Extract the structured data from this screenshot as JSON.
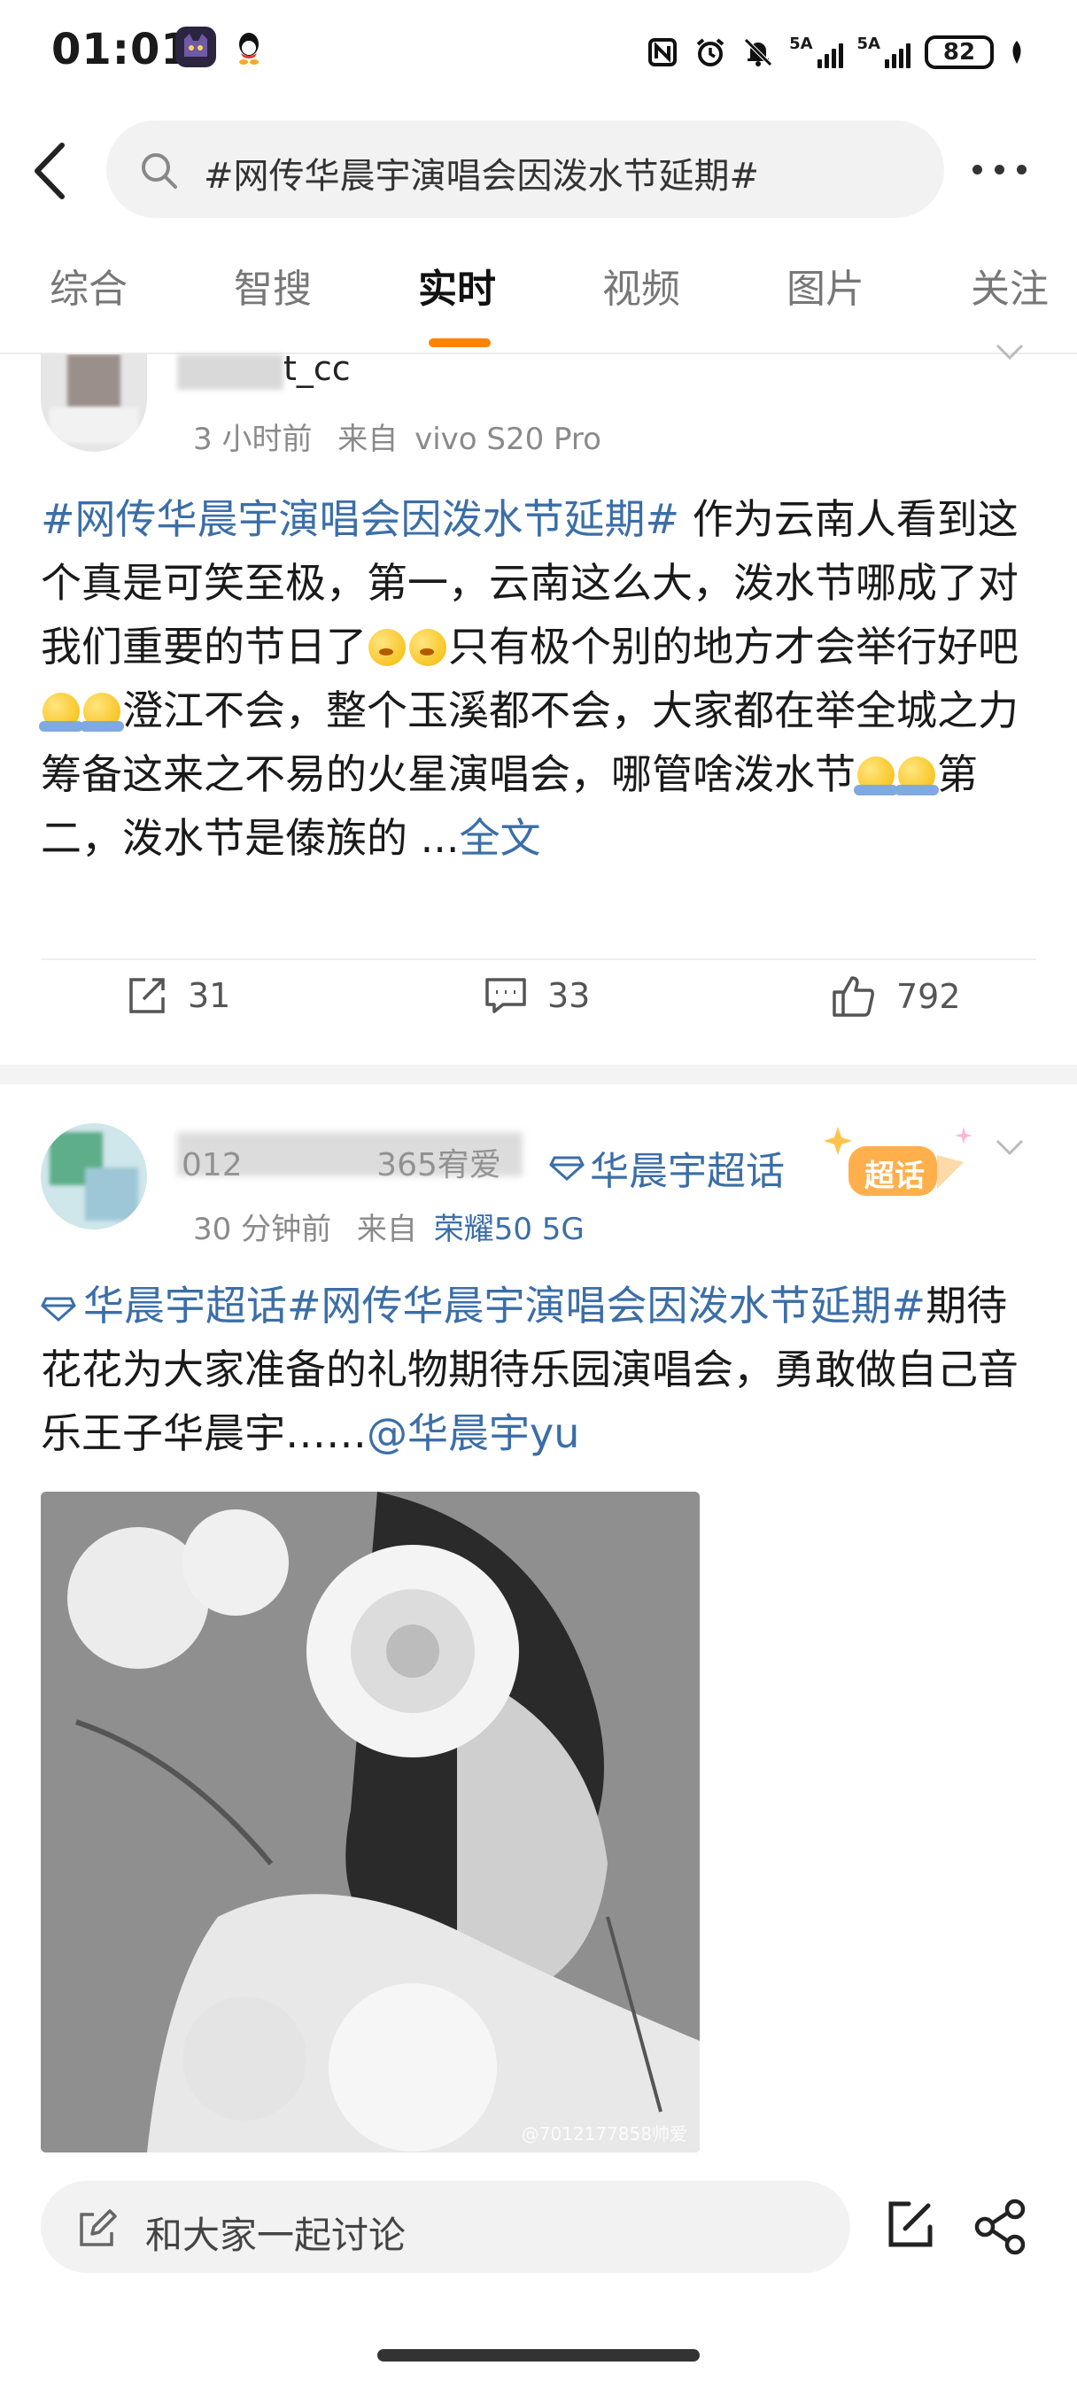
{
  "status_bar": {
    "time": "01:01",
    "signal1_label": "5A",
    "signal2_label": "5A",
    "battery": "82"
  },
  "search": {
    "query": "#网传华晨宇演唱会因泼水节延期#"
  },
  "tabs": [
    {
      "label": "综合",
      "active": false
    },
    {
      "label": "智搜",
      "active": false
    },
    {
      "label": "实时",
      "active": true
    },
    {
      "label": "视频",
      "active": false
    },
    {
      "label": "图片",
      "active": false
    },
    {
      "label": "关注",
      "active": false
    }
  ],
  "post1": {
    "username_visible": "t_cc",
    "time": "3 小时前",
    "source_prefix": "来自",
    "source": "vivo S20 Pro",
    "hashtag": "#网传华晨宇演唱会因泼水节延期#",
    "text_1": " 作为云南人看到这个真是可笑至极，第一，云南这么大，泼水节哪成了对我们重要的节日了",
    "text_2": "只有极个别的地方才会举行好吧",
    "text_3": "澄江不会，整个玉溪都不会，大家都在举全城之力筹备这来之不易的火星演唱会，哪管啥泼水节",
    "text_4": "第二，泼水节是傣族的 ...",
    "more": "全文",
    "reposts": "31",
    "comments": "33",
    "likes": "792"
  },
  "post2": {
    "username_visible": "012",
    "username_visible_2": "365宥爱",
    "supertopic_tag": "华晨宇超话",
    "badge": "超话",
    "time": "30 分钟前",
    "source_prefix": "来自",
    "source": "荣耀50 5G",
    "supertopic_link": "华晨宇超话",
    "hashtag": "#网传华晨宇演唱会因泼水节延期#",
    "text": "期待花花为大家准备的礼物期待乐园演唱会，勇敢做自己音乐王子华晨宇……",
    "mention": "@华晨宇yu",
    "image_watermark": "@7012177858帅爱"
  },
  "bottom_bar": {
    "comment_placeholder": "和大家一起讨论"
  },
  "colors": {
    "accent": "#ff8200",
    "link": "#3b6ea8",
    "meta": "#8a8a8a"
  }
}
